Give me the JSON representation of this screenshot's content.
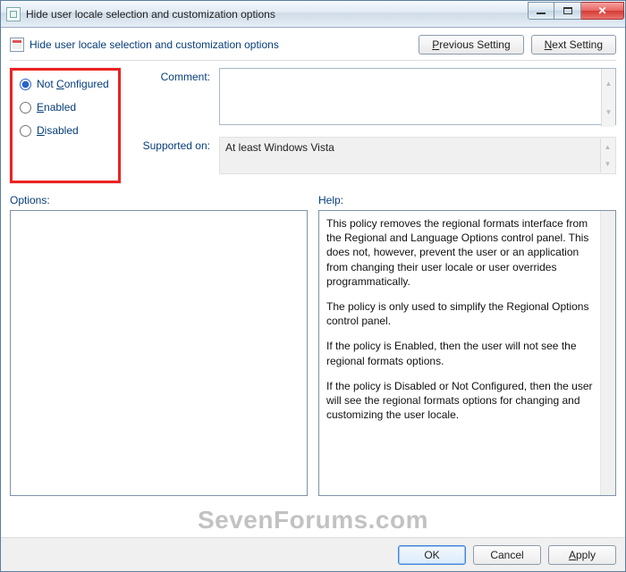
{
  "window": {
    "title": "Hide user locale selection and customization options"
  },
  "header": {
    "title": "Hide user locale selection and customization options",
    "prev_button": "Previous Setting",
    "next_button": "Next Setting",
    "prev_u": "P",
    "next_u": "N"
  },
  "state": {
    "options": [
      {
        "pre": "Not ",
        "u": "C",
        "post": "onfigured",
        "checked": true
      },
      {
        "pre": "",
        "u": "E",
        "post": "nabled",
        "checked": false
      },
      {
        "pre": "",
        "u": "D",
        "post": "isabled",
        "checked": false
      }
    ]
  },
  "fields": {
    "comment_label": "Comment:",
    "comment_value": "",
    "supported_label": "Supported on:",
    "supported_value": "At least Windows Vista"
  },
  "panels": {
    "options_label": "Options:",
    "help_label": "Help:",
    "help_paragraphs": [
      "This policy removes the regional formats interface from the Regional and Language Options control panel.  This does not, however, prevent the user or an application from changing their user locale or user overrides programmatically.",
      "The policy is only used to simplify the Regional Options control panel.",
      "If the policy is Enabled, then the user will not see the regional formats options.",
      "If the policy is Disabled or Not Configured, then the user will see the regional formats options for changing and customizing the user locale."
    ]
  },
  "buttons": {
    "ok": "OK",
    "cancel": "Cancel",
    "apply_pre": "",
    "apply_u": "A",
    "apply_post": "pply"
  },
  "watermark": "SevenForums.com"
}
